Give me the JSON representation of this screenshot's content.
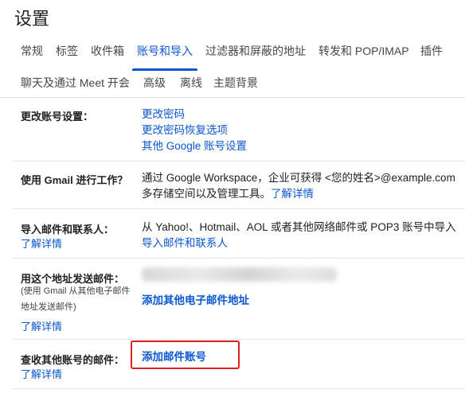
{
  "page": {
    "title": "设置"
  },
  "tabs_row1": [
    {
      "label": "常规"
    },
    {
      "label": "标签"
    },
    {
      "label": "收件箱"
    },
    {
      "label": "账号和导入",
      "active": true
    },
    {
      "label": "过滤器和屏蔽的地址"
    },
    {
      "label": "转发和 POP/IMAP"
    },
    {
      "label": "插件"
    }
  ],
  "tabs_row2": [
    {
      "label": "聊天及通过 Meet 开会"
    },
    {
      "label": "高级"
    },
    {
      "label": "离线"
    },
    {
      "label": "主题背景"
    }
  ],
  "sections": {
    "change_account": {
      "label": "更改账号设置：",
      "links": [
        "更改密码",
        "更改密码恢复选项",
        "其他 Google 账号设置"
      ]
    },
    "workspace": {
      "label": "使用 Gmail 进行工作？",
      "line1": "通过 Google Workspace，企业可获得 <您的姓名>@example.com",
      "line2": "多存储空间以及管理工具。",
      "learn_more": "了解详情"
    },
    "import": {
      "label": "导入邮件和联系人：",
      "learn_more": "了解详情",
      "line1": "从 Yahoo!、Hotmail、AOL 或者其他网络邮件或 POP3 账号中导入",
      "link": "导入邮件和联系人"
    },
    "send_as": {
      "label": "用这个地址发送邮件：",
      "sub1": "(使用 Gmail 从其他电子邮件",
      "sub2": "地址发送邮件)",
      "learn_more": "了解详情",
      "add_link": "添加其他电子邮件地址"
    },
    "check_mail": {
      "label": "查收其他账号的邮件：",
      "learn_more": "了解详情",
      "add_link": "添加邮件账号"
    }
  },
  "colors": {
    "accent": "#0b57d0",
    "highlight": "#e02020"
  }
}
